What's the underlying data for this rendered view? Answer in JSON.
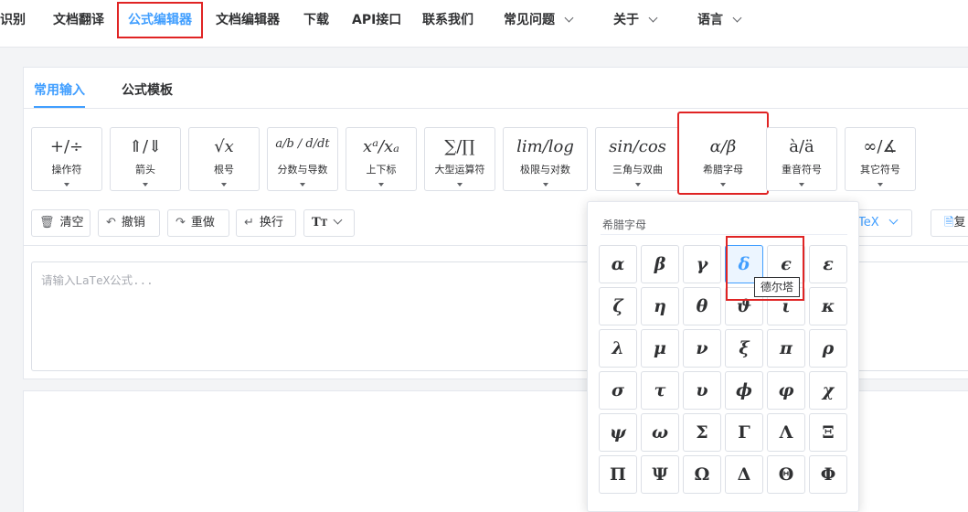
{
  "nav": {
    "items": [
      {
        "label": "转识别"
      },
      {
        "label": "文档翻译"
      },
      {
        "label": "公式编辑器"
      },
      {
        "label": "文档编辑器"
      },
      {
        "label": "下载"
      },
      {
        "label": "API接口"
      },
      {
        "label": "联系我们"
      },
      {
        "label": "常见问题"
      },
      {
        "label": "关于"
      },
      {
        "label": "语言"
      }
    ],
    "first_visible": "识别"
  },
  "tabs": [
    {
      "label": "常用输入"
    },
    {
      "label": "公式模板"
    }
  ],
  "symbol_groups": [
    {
      "glyph": "+/÷",
      "label": "操作符"
    },
    {
      "glyph": "⇑/⇓",
      "label": "箭头"
    },
    {
      "glyph": "√x",
      "label": "根号"
    },
    {
      "glyph": "a/b / d/dt",
      "label": "分数与导数"
    },
    {
      "glyph": "xᵃ/xₐ",
      "label": "上下标"
    },
    {
      "glyph": "∑/∏",
      "label": "大型运算符"
    },
    {
      "glyph": "lim/log",
      "label": "极限与对数"
    },
    {
      "glyph": "sin/cos",
      "label": "三角与双曲"
    },
    {
      "glyph": "α/β",
      "label": "希腊字母"
    },
    {
      "glyph": "à/ä",
      "label": "重音符号"
    },
    {
      "glyph": "∞/∡",
      "label": "其它符号"
    }
  ],
  "toolbar": {
    "clear": "清空",
    "undo": "撤销",
    "redo": "重做",
    "newline": "换行",
    "font": "T",
    "right_partial": "TeX",
    "right_partial2": "复"
  },
  "editor": {
    "placeholder": "请输入LaTeX公式..."
  },
  "greek_popover": {
    "title": "希腊字母",
    "letters": [
      "α",
      "β",
      "γ",
      "δ",
      "ϵ",
      "ε",
      "ζ",
      "η",
      "θ",
      "ϑ",
      "ι",
      "κ",
      "λ",
      "μ",
      "ν",
      "ξ",
      "π",
      "ρ",
      "σ",
      "τ",
      "υ",
      "ϕ",
      "φ",
      "χ",
      "ψ",
      "ω",
      "Σ",
      "Γ",
      "Λ",
      "Ξ",
      "Π",
      "Ψ",
      "Ω",
      "Δ",
      "Θ",
      "Φ"
    ],
    "selected": "δ",
    "tooltip": "德尔塔"
  },
  "colors": {
    "accent": "#409eff",
    "highlight": "#e02424"
  }
}
